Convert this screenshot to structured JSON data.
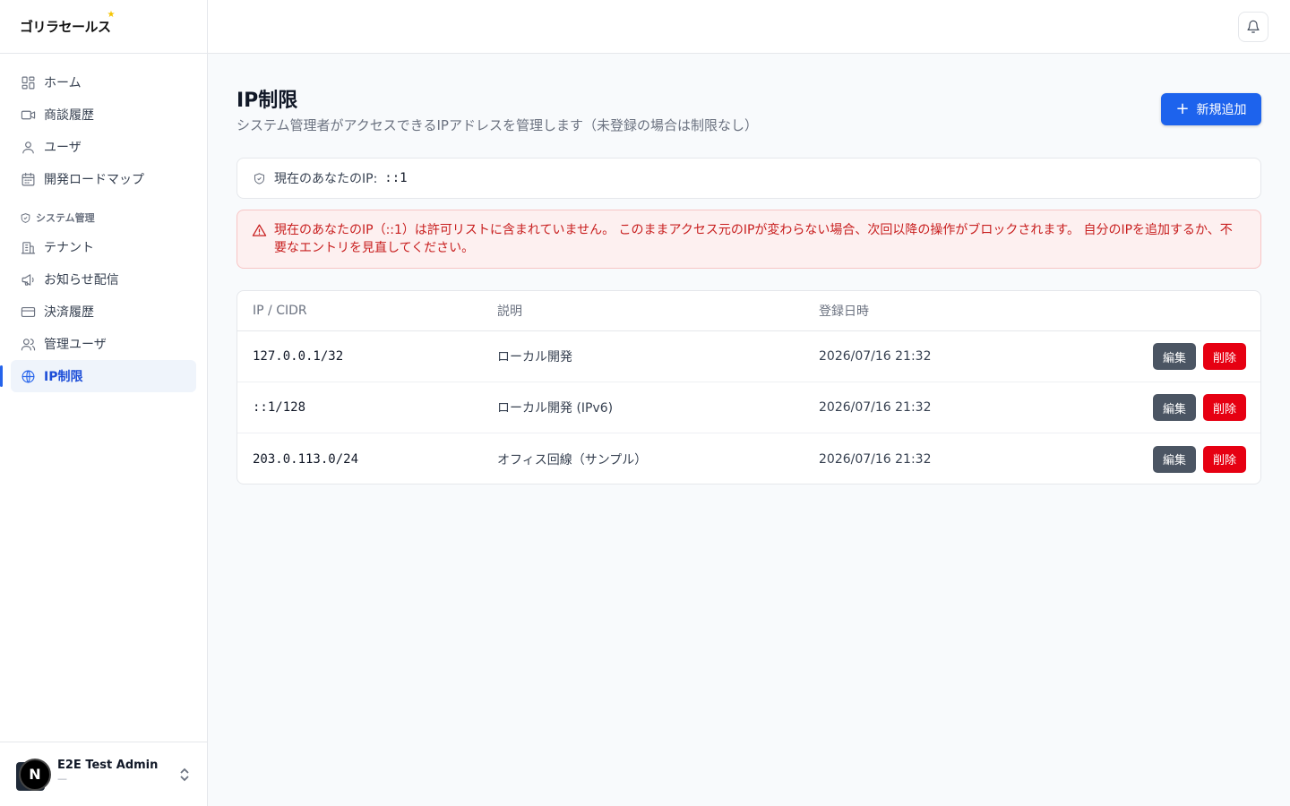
{
  "app": {
    "logo_text": "ゴリラセールス"
  },
  "sidebar": {
    "items": [
      {
        "label": "ホーム",
        "icon": "dashboard-icon"
      },
      {
        "label": "商談履歴",
        "icon": "video-icon"
      },
      {
        "label": "ユーザ",
        "icon": "user-icon"
      },
      {
        "label": "開発ロードマップ",
        "icon": "calendar-icon"
      }
    ],
    "section_label": "システム管理",
    "admin_items": [
      {
        "label": "テナント",
        "icon": "building-icon"
      },
      {
        "label": "お知らせ配信",
        "icon": "megaphone-icon"
      },
      {
        "label": "決済履歴",
        "icon": "credit-card-icon"
      },
      {
        "label": "管理ユーザ",
        "icon": "users-icon"
      },
      {
        "label": "IP制限",
        "icon": "globe-icon",
        "active": true
      }
    ],
    "user": {
      "avatar_letter": "N",
      "name": "E2E Test Admin",
      "sub": "—"
    }
  },
  "page": {
    "title": "IP制限",
    "subtitle": "システム管理者がアクセスできるIPアドレスを管理します（未登録の場合は制限なし）",
    "add_button": "新規追加",
    "current_ip_label": "現在のあなたのIP:",
    "current_ip_value": "::1",
    "alert_text": "現在のあなたのIP（::1）は許可リストに含まれていません。 このままアクセス元のIPが変わらない場合、次回以降の操作がブロックされます。 自分のIPを追加するか、不要なエントリを見直してください。"
  },
  "table": {
    "headers": {
      "ip": "IP / CIDR",
      "desc": "説明",
      "date": "登録日時"
    },
    "edit_label": "編集",
    "delete_label": "削除",
    "rows": [
      {
        "ip": "127.0.0.1/32",
        "desc": "ローカル開発",
        "date": "2026/07/16 21:32"
      },
      {
        "ip": "::1/128",
        "desc": "ローカル開発 (IPv6)",
        "date": "2026/07/16 21:32"
      },
      {
        "ip": "203.0.113.0/24",
        "desc": "オフィス回線（サンプル）",
        "date": "2026/07/16 21:32"
      }
    ]
  },
  "colors": {
    "primary": "#1d63ed",
    "danger": "#e60012",
    "alert_bg": "#fdf0f0",
    "alert_text": "#c81e1e"
  }
}
